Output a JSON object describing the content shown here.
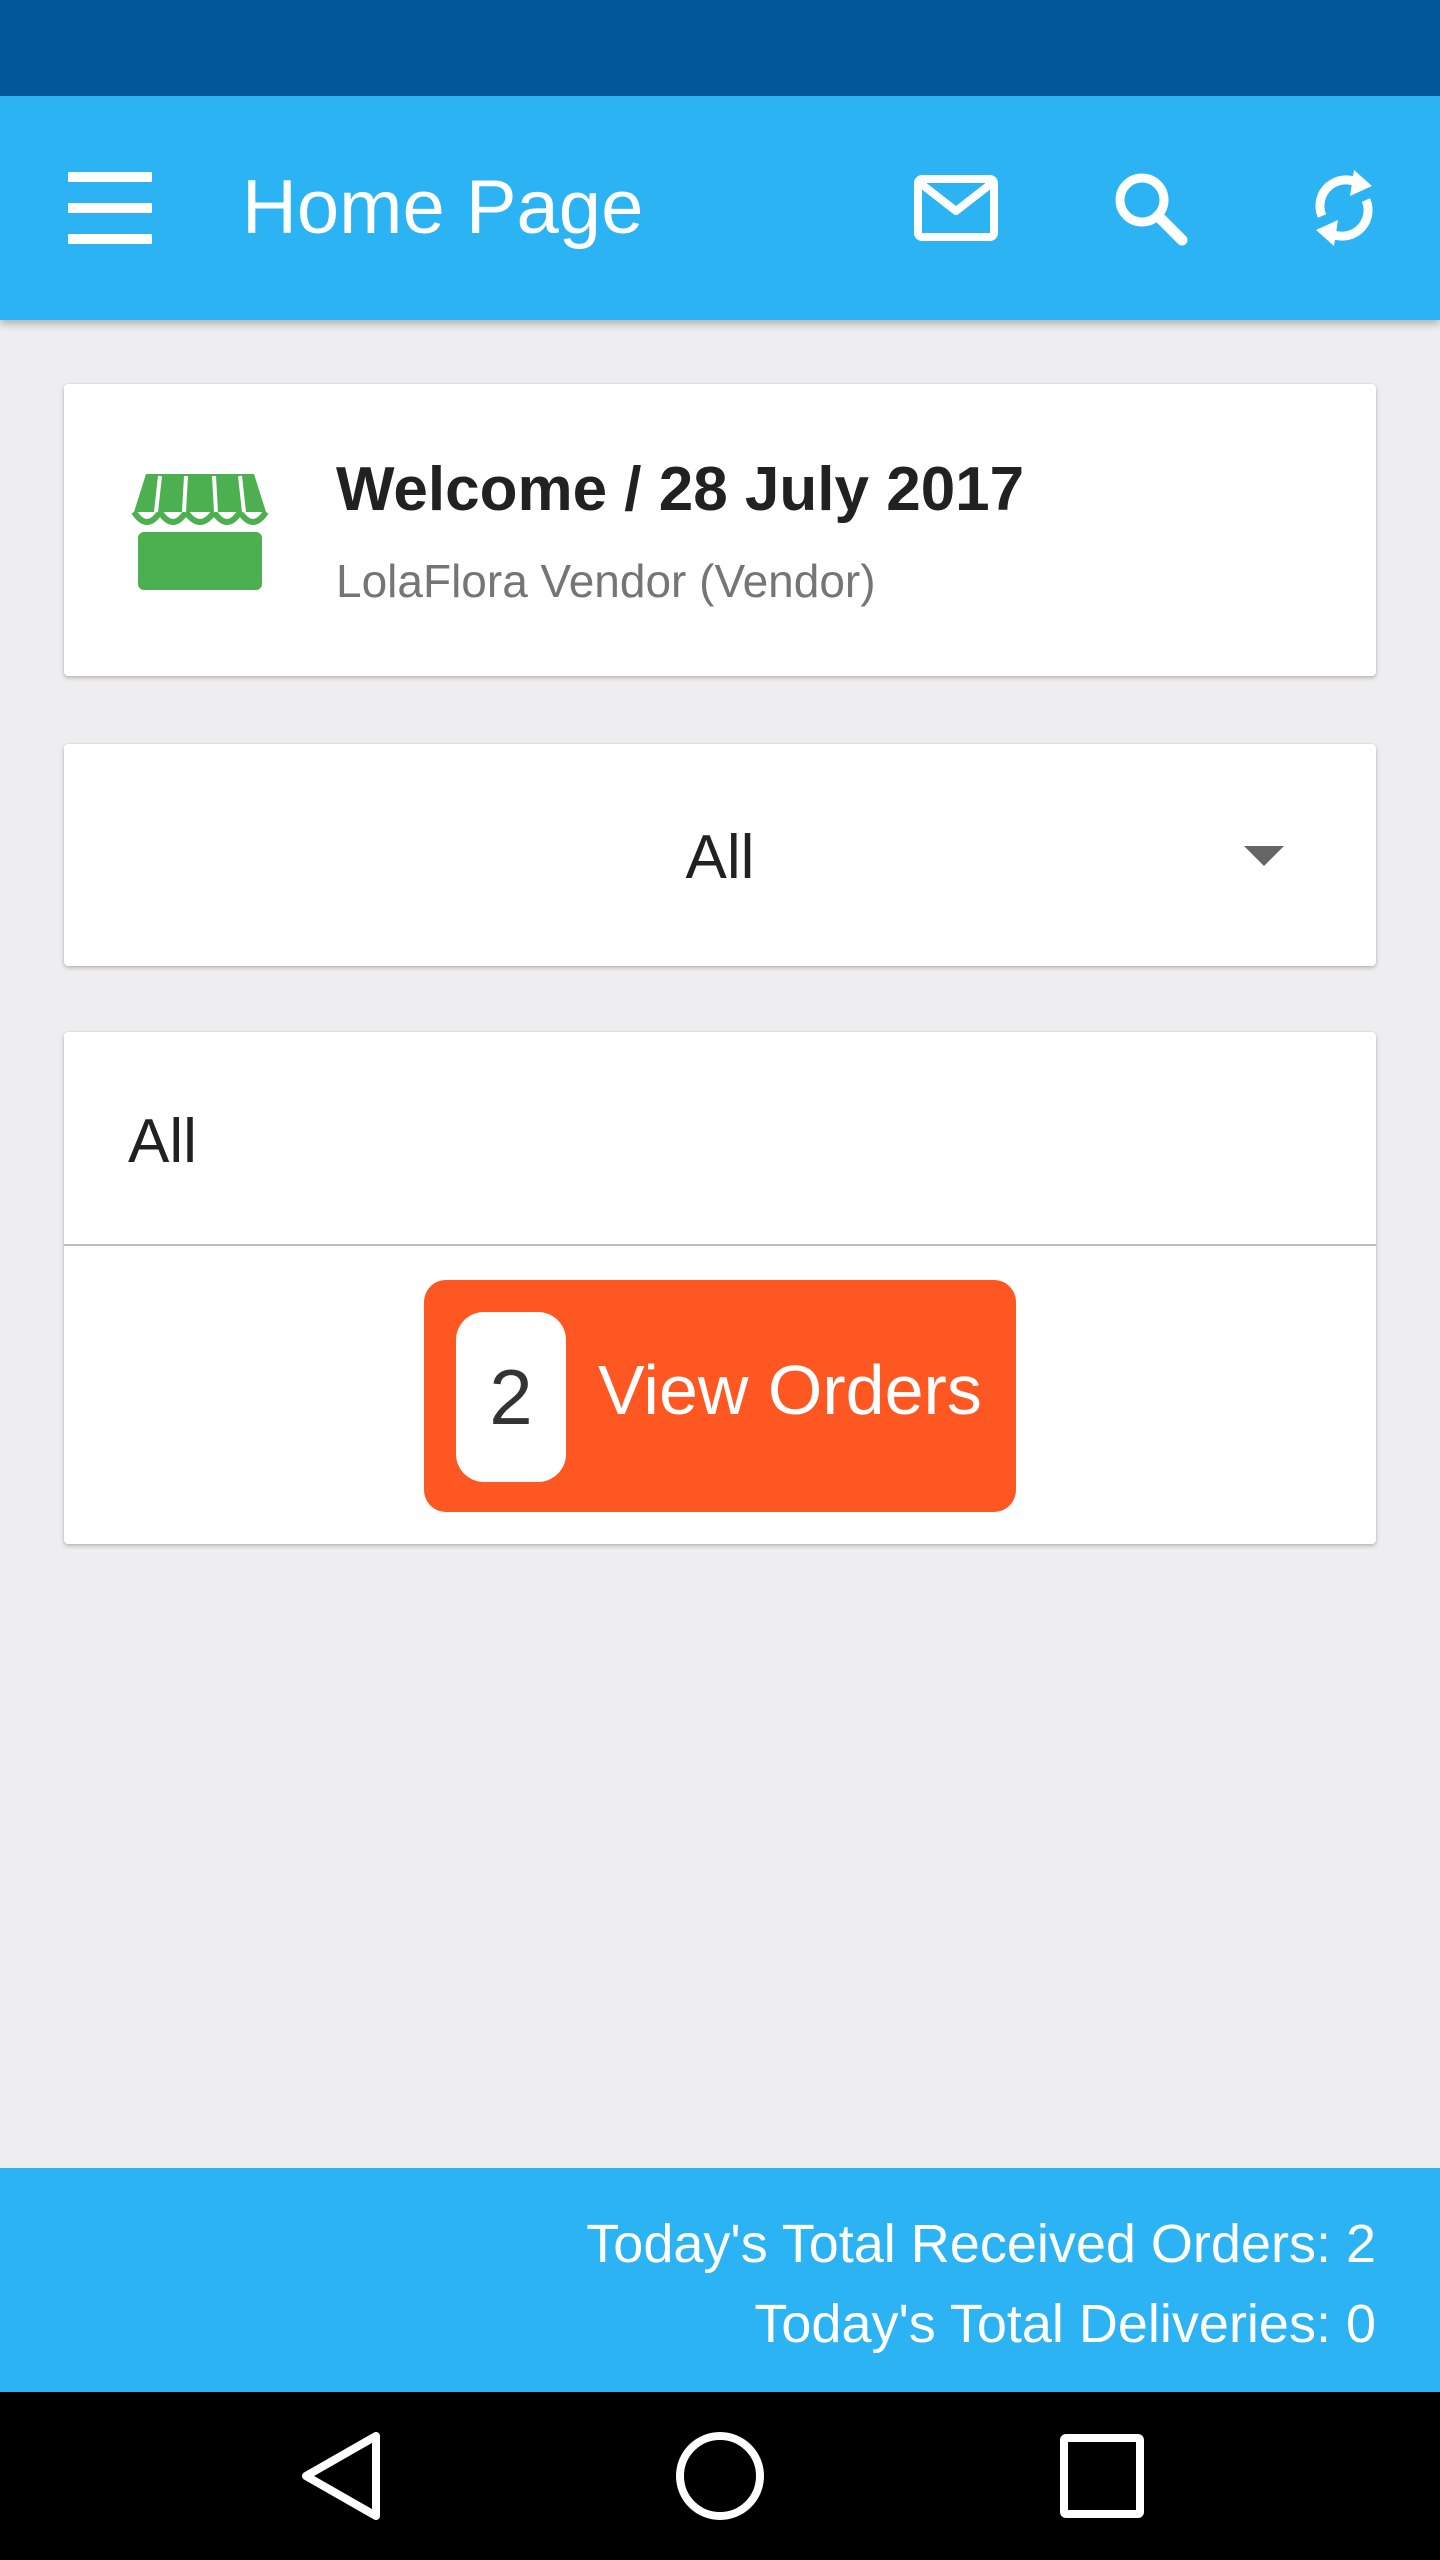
{
  "app_bar": {
    "title": "Home Page",
    "icons": [
      "menu-icon",
      "mail-icon",
      "search-icon",
      "refresh-icon"
    ],
    "color": "#2cb3f3"
  },
  "welcome": {
    "title": "Welcome / 28 July 2017",
    "subtitle": "LolaFlora Vendor (Vendor)",
    "icon": "store-icon",
    "icon_color": "#4caf50"
  },
  "filter": {
    "selected": "All"
  },
  "orders": {
    "label": "All",
    "count": "2",
    "button_label": "View Orders",
    "button_color": "#ff5722"
  },
  "footer": {
    "received": "Today's Total Received Orders: 2",
    "deliveries": "Today's Total Deliveries: 0"
  },
  "nav": {
    "icons": [
      "back-icon",
      "home-icon",
      "recent-apps-icon"
    ]
  }
}
